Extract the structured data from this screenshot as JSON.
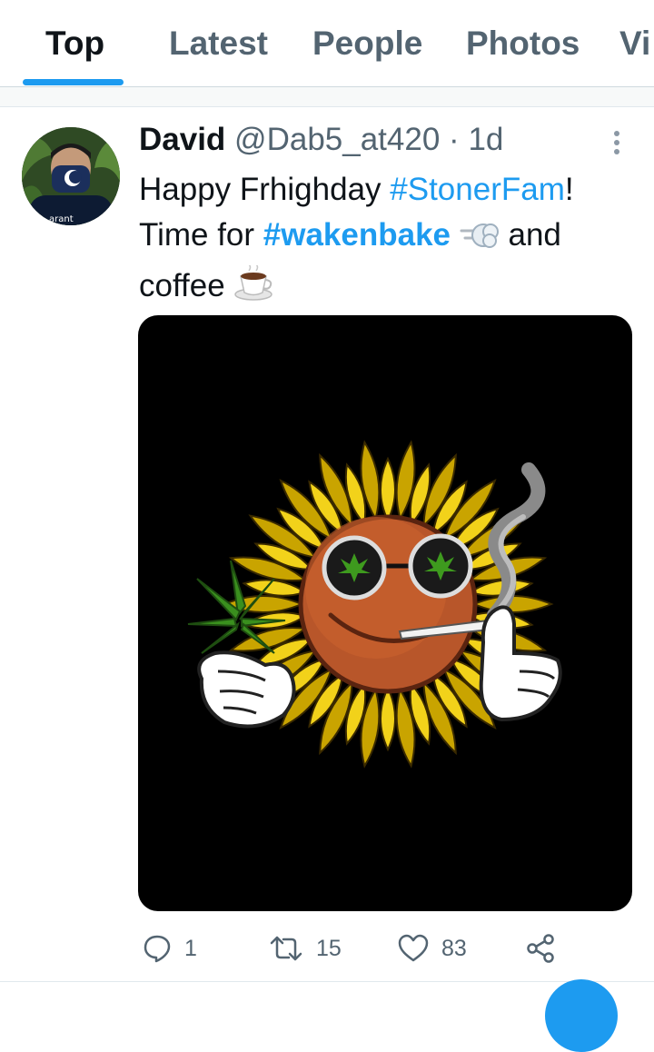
{
  "tabs": [
    {
      "label": "Top",
      "active": true
    },
    {
      "label": "Latest",
      "active": false
    },
    {
      "label": "People",
      "active": false
    },
    {
      "label": "Photos",
      "active": false
    },
    {
      "label": "Vi",
      "active": false
    }
  ],
  "tweet": {
    "author": "David",
    "handle": "@Dab5_at420",
    "separator": "·",
    "time": "1d",
    "text": {
      "line1_prefix": "Happy Frhighday ",
      "hashtag1": "#StonerFam",
      "line1_suffix": "!",
      "line2_prefix": "Time for ",
      "hashtag2": "#wakenbake",
      "line2_suffix": " and",
      "line3": "coffee "
    },
    "stats": {
      "replies": "1",
      "retweets": "15",
      "likes": "83"
    }
  },
  "colors": {
    "accent": "#1d9bf0",
    "text": "#0f1419",
    "muted": "#536471"
  },
  "icons": {
    "reply": "reply-icon",
    "retweet": "retweet-icon",
    "like": "heart-icon",
    "share": "share-icon",
    "more": "more-vertical-icon"
  }
}
